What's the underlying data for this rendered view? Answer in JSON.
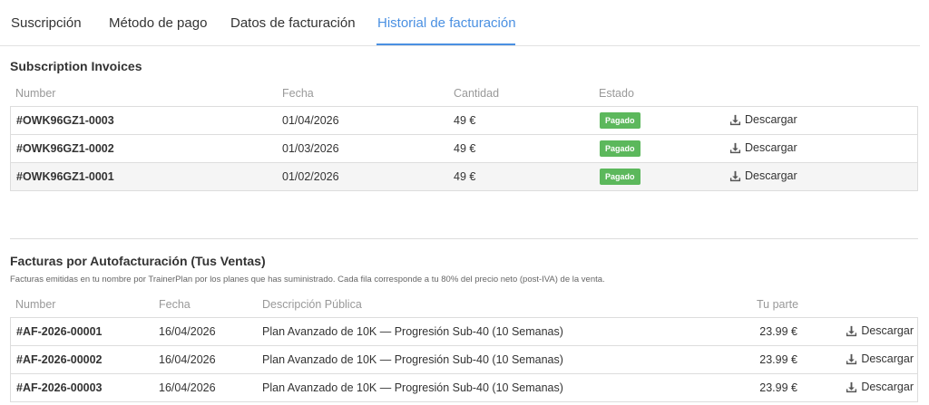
{
  "tabs": [
    {
      "label": "Suscripción"
    },
    {
      "label": "Método de pago"
    },
    {
      "label": "Datos de facturación"
    },
    {
      "label": "Historial de facturación"
    }
  ],
  "subscription": {
    "title": "Subscription Invoices",
    "headers": {
      "number": "Number",
      "date": "Fecha",
      "amount": "Cantidad",
      "status": "Estado"
    },
    "rows": [
      {
        "number": "#OWK96GZ1-0003",
        "date": "01/04/2026",
        "amount": "49 €",
        "status": "Pagado",
        "download": "Descargar"
      },
      {
        "number": "#OWK96GZ1-0002",
        "date": "01/03/2026",
        "amount": "49 €",
        "status": "Pagado",
        "download": "Descargar"
      },
      {
        "number": "#OWK96GZ1-0001",
        "date": "01/02/2026",
        "amount": "49 €",
        "status": "Pagado",
        "download": "Descargar"
      }
    ]
  },
  "selfbilling": {
    "title": "Facturas por Autofacturación (Tus Ventas)",
    "description": "Facturas emitidas en tu nombre por TrainerPlan por los planes que has suministrado. Cada fila corresponde a tu 80% del precio neto (post-IVA) de la venta.",
    "headers": {
      "number": "Number",
      "date": "Fecha",
      "desc": "Descripción Pública",
      "share": "Tu parte"
    },
    "rows": [
      {
        "number": "#AF-2026-00001",
        "date": "16/04/2026",
        "desc": "Plan Avanzado de 10K — Progresión Sub-40 (10 Semanas)",
        "share": "23.99 €",
        "download": "Descargar"
      },
      {
        "number": "#AF-2026-00002",
        "date": "16/04/2026",
        "desc": "Plan Avanzado de 10K — Progresión Sub-40 (10 Semanas)",
        "share": "23.99 €",
        "download": "Descargar"
      },
      {
        "number": "#AF-2026-00003",
        "date": "16/04/2026",
        "desc": "Plan Avanzado de 10K — Progresión Sub-40 (10 Semanas)",
        "share": "23.99 €",
        "download": "Descargar"
      }
    ]
  },
  "colors": {
    "accent": "#4a90e2",
    "paid": "#5cb85c"
  },
  "icons": {
    "download": "download-icon"
  }
}
